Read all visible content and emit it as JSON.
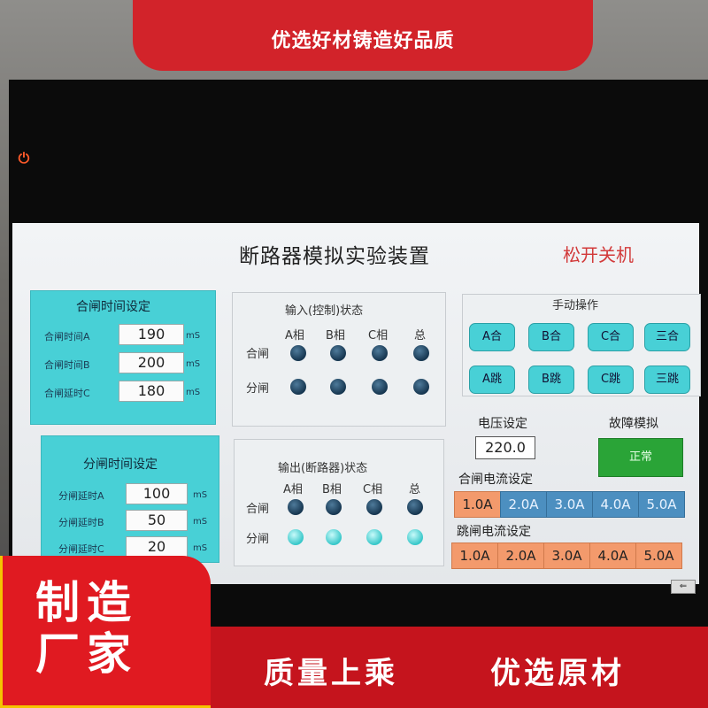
{
  "banner": {
    "top": "优选好材铸造好品质",
    "bottom_left_line1": "制造",
    "bottom_left_line2": "厂家",
    "bottom_mid": "质量上乘",
    "bottom_right": "优选原材"
  },
  "app": {
    "title": "断路器模拟实验装置",
    "shutdown": "松开关机"
  },
  "close_time": {
    "title": "合闸时间设定",
    "unit": "mS",
    "rows": [
      {
        "label": "合闸时间A",
        "value": "190"
      },
      {
        "label": "合闸时间B",
        "value": "200"
      },
      {
        "label": "合闸延时C",
        "value": "180"
      }
    ]
  },
  "open_time": {
    "title": "分闸时间设定",
    "unit": "mS",
    "rows": [
      {
        "label": "分闸延时A",
        "value": "100"
      },
      {
        "label": "分闸延时B",
        "value": "50"
      },
      {
        "label": "分闸延时C",
        "value": "20"
      }
    ]
  },
  "input_state": {
    "title": "输入(控制)状态",
    "cols": [
      "A相",
      "B相",
      "C相",
      "总"
    ],
    "rows": [
      "合闸",
      "分闸"
    ]
  },
  "output_state": {
    "title": "输出(断路器)状态",
    "cols": [
      "A相",
      "B相",
      "C相",
      "总"
    ],
    "rows": [
      "合闸",
      "分闸"
    ]
  },
  "manual": {
    "title": "手动操作",
    "close_buttons": [
      "A合",
      "B合",
      "C合",
      "三合"
    ],
    "trip_buttons": [
      "A跳",
      "B跳",
      "C跳",
      "三跳"
    ]
  },
  "voltage": {
    "label": "电压设定",
    "value": "220.0"
  },
  "fault": {
    "label": "故障模拟",
    "value": "正常"
  },
  "close_current": {
    "label": "合闸电流设定",
    "values": [
      "1.0A",
      "2.0A",
      "3.0A",
      "4.0A",
      "5.0A"
    ]
  },
  "trip_current": {
    "label": "跳闸电流设定",
    "values": [
      "1.0A",
      "2.0A",
      "3.0A",
      "4.0A",
      "5.0A"
    ]
  },
  "colors": {
    "panel": "#48d0d6",
    "red": "#d2232a",
    "green": "#2aa437",
    "orange": "#f39a6c",
    "blue": "#4c8fc0"
  }
}
